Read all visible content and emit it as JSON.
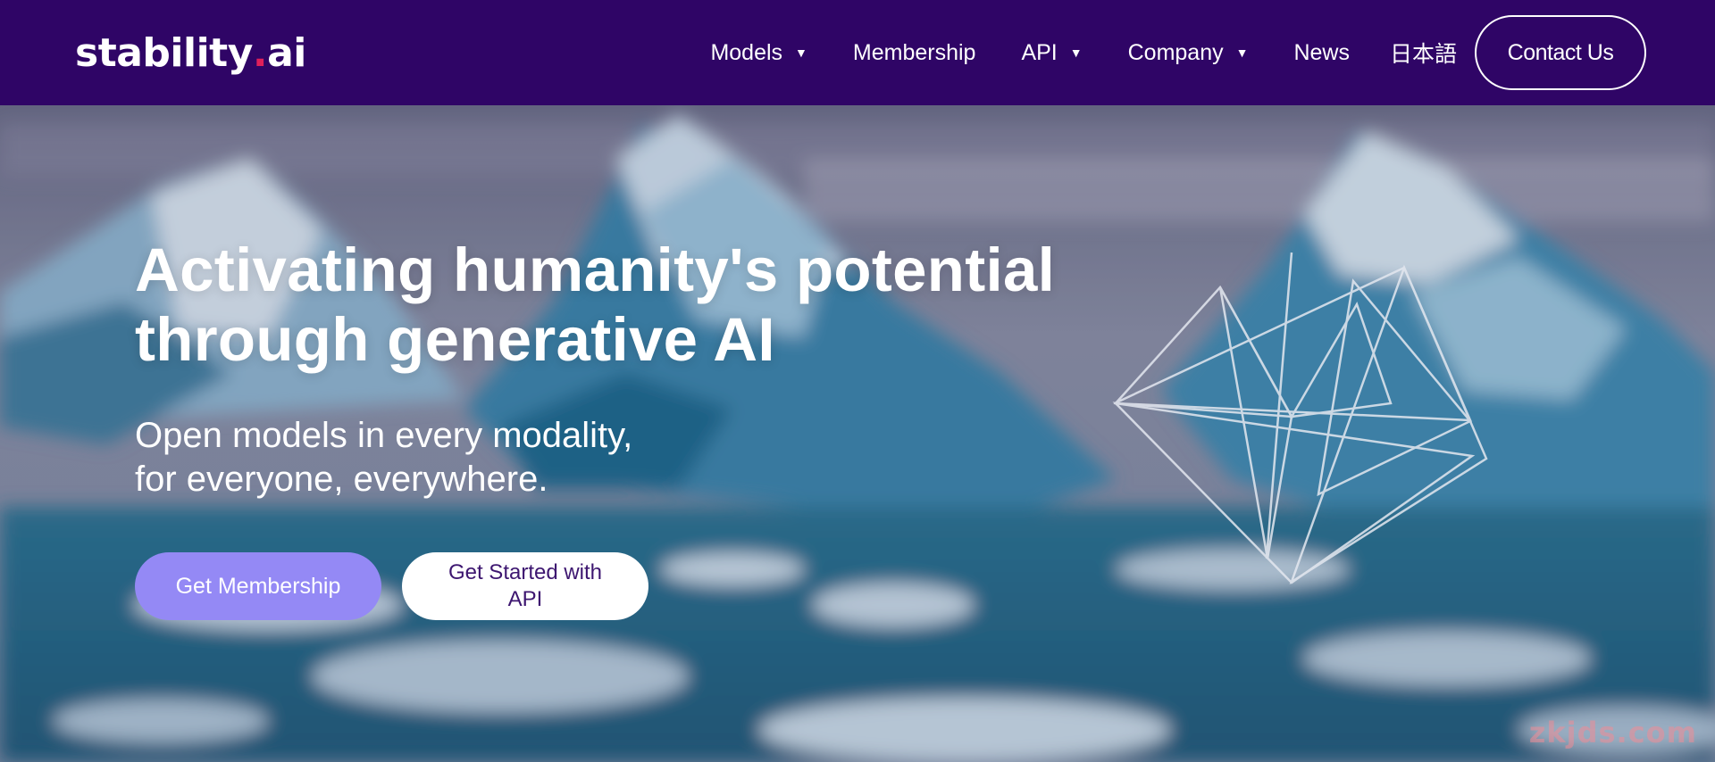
{
  "brand": {
    "logo_main": "stability",
    "logo_dot": ".",
    "logo_suffix": "ai",
    "dot_color": "#e0205a"
  },
  "nav": {
    "items": [
      {
        "label": "Models",
        "has_dropdown": true
      },
      {
        "label": "Membership",
        "has_dropdown": false
      },
      {
        "label": "API",
        "has_dropdown": true
      },
      {
        "label": "Company",
        "has_dropdown": true
      },
      {
        "label": "News",
        "has_dropdown": false
      }
    ],
    "caret_glyph": "▼",
    "language": "日本語",
    "contact_label": "Contact Us"
  },
  "hero": {
    "headline_line1": "Activating humanity's potential",
    "headline_line2": "through generative AI",
    "subhead_line1": "Open models in every modality,",
    "subhead_line2": "for everyone, everywhere.",
    "primary_cta": "Get Membership",
    "secondary_cta": "Get Started with API"
  },
  "watermark": "zkjds.com",
  "colors": {
    "nav_bg": "#2f0566",
    "primary_button": "#9489f5",
    "secondary_button_text": "#3d1670"
  }
}
